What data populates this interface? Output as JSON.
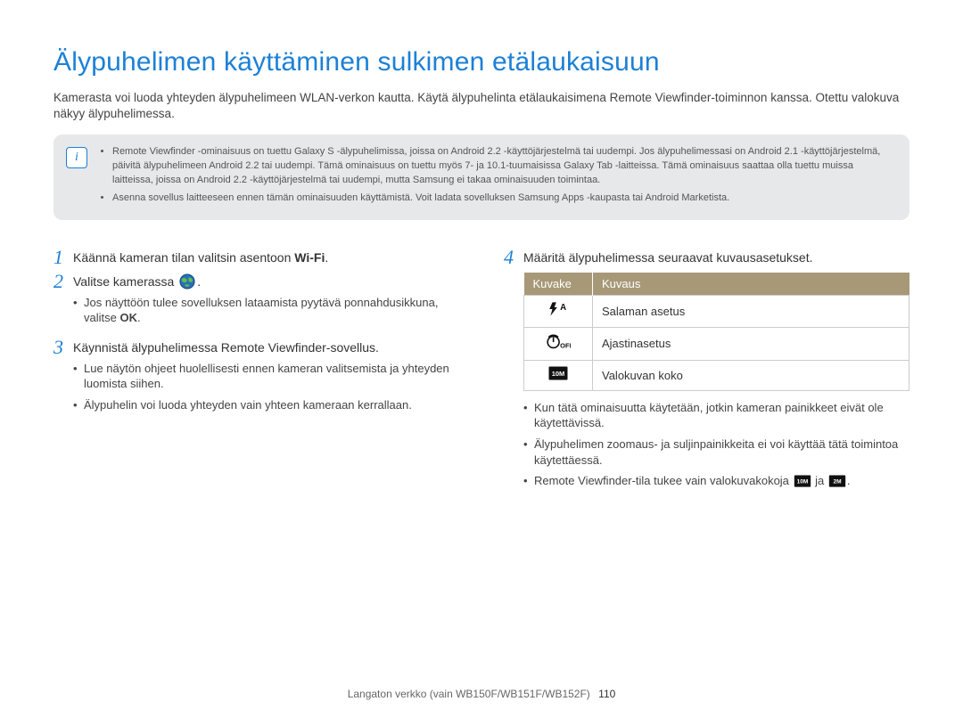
{
  "title": "Älypuhelimen käyttäminen sulkimen etälaukaisuun",
  "intro": "Kamerasta voi luoda yhteyden älypuhelimeen WLAN-verkon kautta. Käytä älypuhelinta etälaukaisimena Remote Viewfinder-toiminnon kanssa. Otettu valokuva näkyy älypuhelimessa.",
  "notes": {
    "items": [
      "Remote Viewfinder -ominaisuus on tuettu Galaxy S -älypuhelimissa, joissa on Android 2.2 -käyttöjärjestelmä tai uudempi. Jos älypuhelimessasi on Android 2.1 -käyttöjärjestelmä, päivitä älypuhelimeen Android 2.2 tai uudempi. Tämä ominaisuus on tuettu myös 7- ja 10.1-tuumaisissa Galaxy Tab -laitteissa. Tämä ominaisuus saattaa olla tuettu muissa laitteissa, joissa on Android 2.2 -käyttöjärjestelmä tai uudempi, mutta Samsung ei takaa ominaisuuden toimintaa.",
      "Asenna sovellus laitteeseen ennen tämän ominaisuuden käyttämistä. Voit ladata sovelluksen Samsung Apps -kaupasta tai Android Marketista."
    ]
  },
  "steps": {
    "s1": "Käännä kameran tilan valitsin asentoon",
    "s1_wifi": "Wi-Fi",
    "s1_tail": ".",
    "s2": "Valitse kamerassa",
    "s2_tail": ".",
    "s2_sub1a": "Jos näyttöön tulee sovelluksen lataamista pyytävä ponnahdusikkuna, valitse ",
    "s2_sub1_ok": "OK",
    "s2_sub1b": ".",
    "s3": "Käynnistä älypuhelimessa Remote Viewfinder-sovellus.",
    "s3_sub1": "Lue näytön ohjeet huolellisesti ennen kameran valitsemista ja yhteyden luomista siihen.",
    "s3_sub2": "Älypuhelin voi luoda yhteyden vain yhteen kameraan kerrallaan.",
    "s4": "Määritä älypuhelimessa seuraavat kuvausasetukset."
  },
  "table": {
    "h_icon": "Kuvake",
    "h_desc": "Kuvaus",
    "rows": [
      {
        "icon": "flash",
        "desc": "Salaman asetus"
      },
      {
        "icon": "timer",
        "desc": "Ajastinasetus"
      },
      {
        "icon": "size10m",
        "desc": "Valokuvan koko"
      }
    ]
  },
  "postlist": {
    "i1": "Kun tätä ominaisuutta käytetään, jotkin kameran painikkeet eivät ole käytettävissä.",
    "i2": "Älypuhelimen zoomaus- ja suljinpainikkeita ei voi käyttää tätä toimintoa käytettäessä.",
    "i3a": "Remote Viewfinder-tila tukee vain valokuvakokoja ",
    "i3b": " ja ",
    "i3c": "."
  },
  "footer": {
    "text": "Langaton verkko (vain WB150F/WB151F/WB152F)",
    "page": "110"
  }
}
